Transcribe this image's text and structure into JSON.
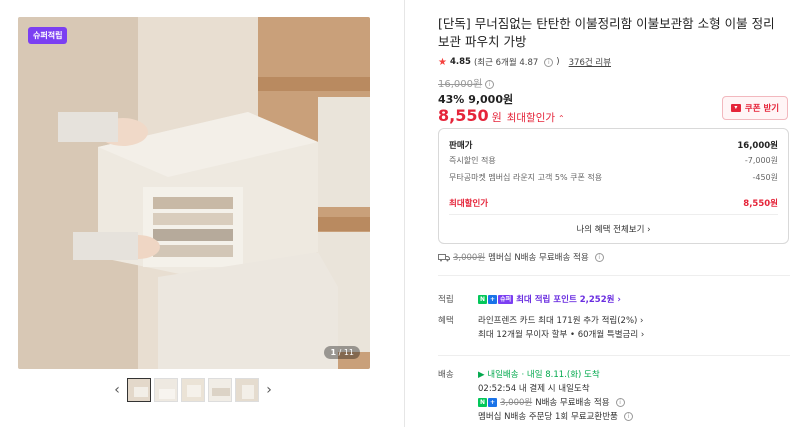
{
  "product": {
    "badge": "슈퍼적립",
    "image_counter_current": "1",
    "image_counter_total": "/ 11",
    "title": "[단독] 무너짐없는 탄탄한 이불정리함 이불보관함 소형 이불 정리 보관 파우치 가방",
    "rating": {
      "score": "4.85",
      "recent": "(최근 6개월 4.87",
      "recent_close": ")",
      "reviews": "376건 리뷰"
    },
    "original_price": "16,000원",
    "discount_rate": "43%",
    "discount_price": "9,000원",
    "final_price": "8,550",
    "final_won": "원",
    "final_label": "최대할인가",
    "coupon_button": "쿠폰 받기"
  },
  "breakdown": {
    "rows": [
      {
        "label": "판매가",
        "value": "16,000원"
      },
      {
        "label": "즉시할인 적용",
        "value": "-7,000원"
      },
      {
        "label": "무타공마켓 멤버십 라운지 고객 5% 쿠폰 적용",
        "value": "-450원"
      }
    ],
    "max_label": "최대할인가",
    "max_value": "8,550원",
    "all_benefits": "나의 혜택 전체보기 ›"
  },
  "shipping_line": {
    "strike": "3,000원",
    "text": "멤버십 N배송 무료배송 적용"
  },
  "details": {
    "points_label": "적립",
    "points_tag": "슈퍼",
    "points_text": "최대 적립 포인트 2,252원 ›",
    "benefit_label": "혜택",
    "benefit_line1": "라인프렌즈 카드 최대 171원 추가 적립(2%) ›",
    "benefit_line2": "최대 12개월 무이자 할부 • 60개월 특별금리 ›",
    "delivery_label": "배송",
    "delivery_tag": "내일배송",
    "delivery_eta": "· 내일 8.11.(화) 도착",
    "delivery_deadline": "02:52:54  내 결제 시 내일도착",
    "delivery_strike": "3,000원",
    "delivery_free": "N배송 무료배송 적용",
    "delivery_return": "멤버십 N배송 주문당 1회 무료교환반품"
  },
  "colors": {
    "accent_red": "#e5253a",
    "purple": "#7b3ff2",
    "green": "#03a94e"
  }
}
